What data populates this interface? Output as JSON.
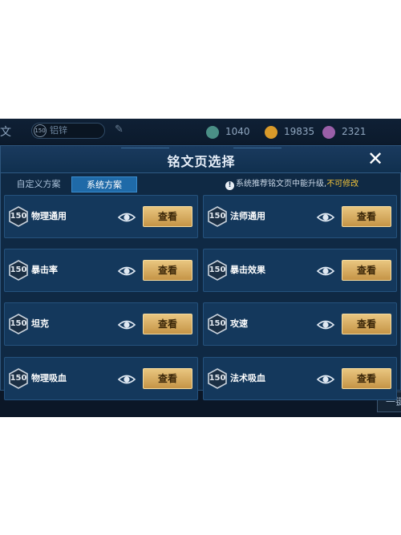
{
  "background": {
    "left_char": "文",
    "input_badge": "150",
    "input_text": "铝锌",
    "currencies": [
      {
        "icon": "gem-icon",
        "color": "#4a8f86",
        "value": "1040"
      },
      {
        "icon": "gold-coin-icon",
        "color": "#d99a2a",
        "value": "19835"
      },
      {
        "icon": "purple-crystal-icon",
        "color": "#9a5fa8",
        "value": "2321"
      }
    ],
    "bottom_button": "一键"
  },
  "modal": {
    "title": "铭文页选择",
    "tabs": [
      {
        "label": "自定义方案",
        "active": false
      },
      {
        "label": "系统方案",
        "active": true
      }
    ],
    "notice": {
      "info_icon": "!",
      "text": "系统推荐铭文页中能升级,",
      "warning": "不可修改"
    },
    "view_label": "查看",
    "pages": [
      {
        "level": "150",
        "name": "物理通用"
      },
      {
        "level": "150",
        "name": "法师通用"
      },
      {
        "level": "150",
        "name": "暴击率"
      },
      {
        "level": "150",
        "name": "暴击效果"
      },
      {
        "level": "150",
        "name": "坦克"
      },
      {
        "level": "150",
        "name": "攻速"
      },
      {
        "level": "150",
        "name": "物理吸血"
      },
      {
        "level": "150",
        "name": "法术吸血"
      }
    ]
  }
}
